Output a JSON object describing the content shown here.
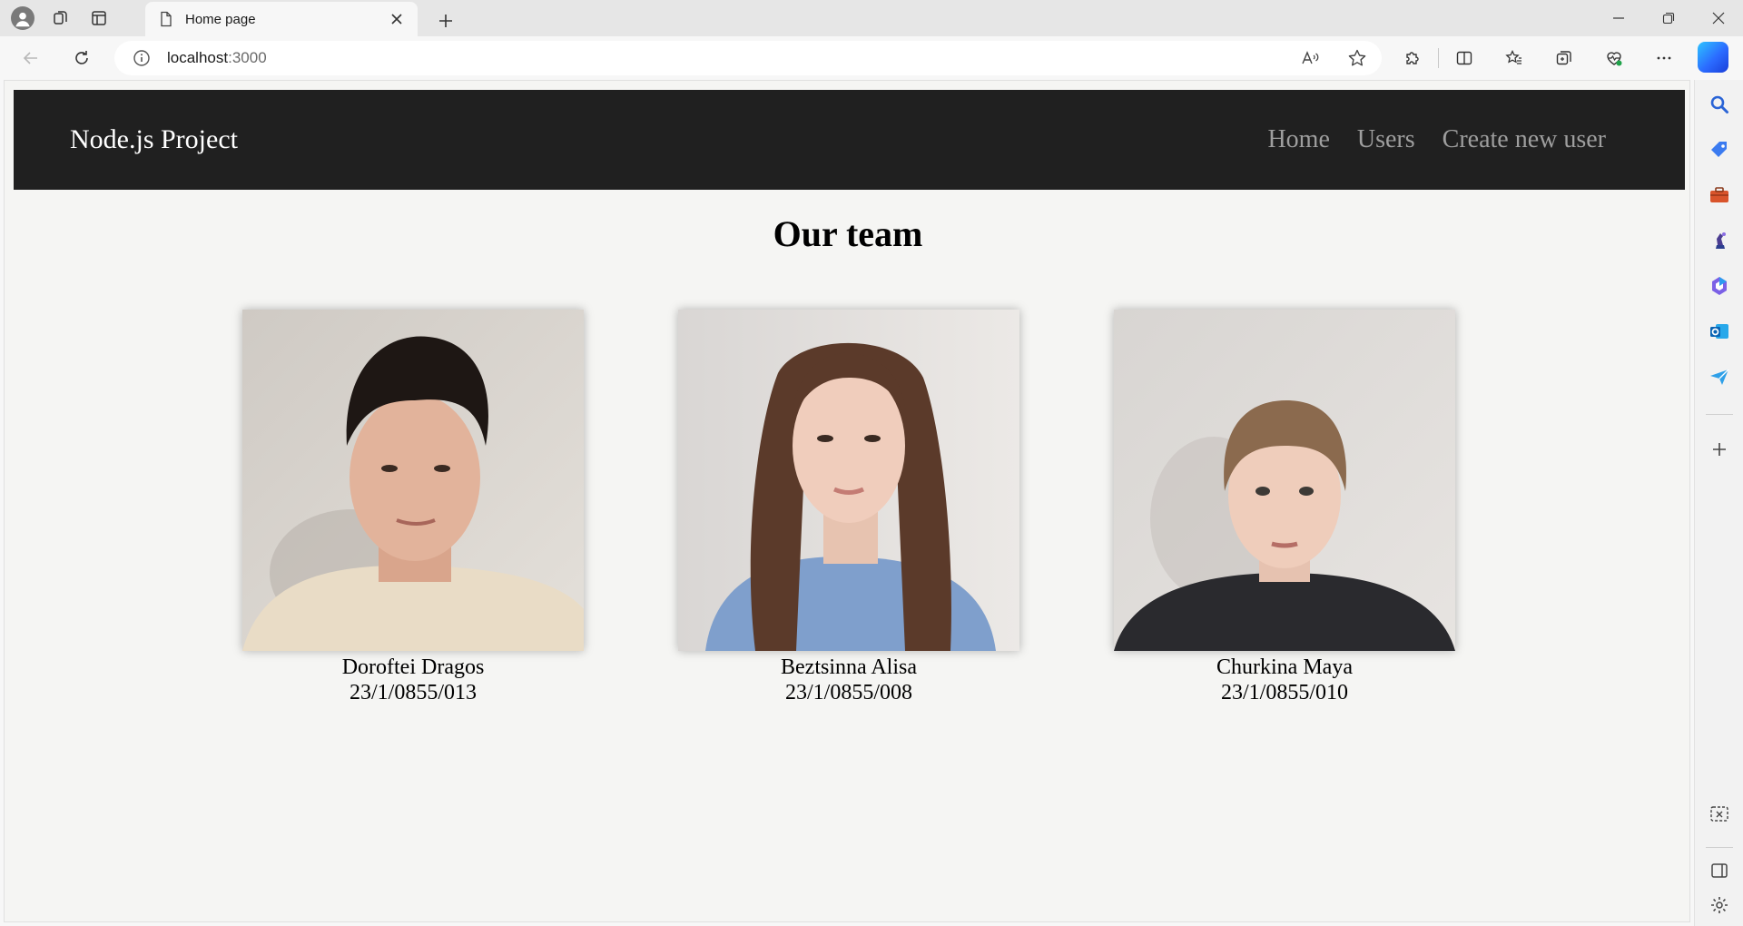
{
  "browser": {
    "tab_title": "Home page",
    "url_host": "localhost",
    "url_port": ":3000"
  },
  "site": {
    "brand": "Node.js Project",
    "nav": [
      {
        "label": "Home"
      },
      {
        "label": "Users"
      },
      {
        "label": "Create new user"
      }
    ],
    "section_title": "Our team",
    "members": [
      {
        "name": "Doroftei Dragos",
        "id": "23/1/0855/013"
      },
      {
        "name": "Beztsinna Alisa",
        "id": "23/1/0855/008"
      },
      {
        "name": "Churkina Maya",
        "id": "23/1/0855/010"
      }
    ]
  },
  "colors": {
    "navbar_bg": "#202020",
    "nav_link": "#9e9e9e",
    "page_bg": "#f5f5f3"
  },
  "icons": {
    "sidebar": [
      "search-icon",
      "tag-icon",
      "briefcase-icon",
      "chess-icon",
      "microsoft365-icon",
      "outlook-icon",
      "send-icon",
      "add-icon",
      "screenshot-icon",
      "sidebar-toggle-icon",
      "settings-icon"
    ]
  }
}
